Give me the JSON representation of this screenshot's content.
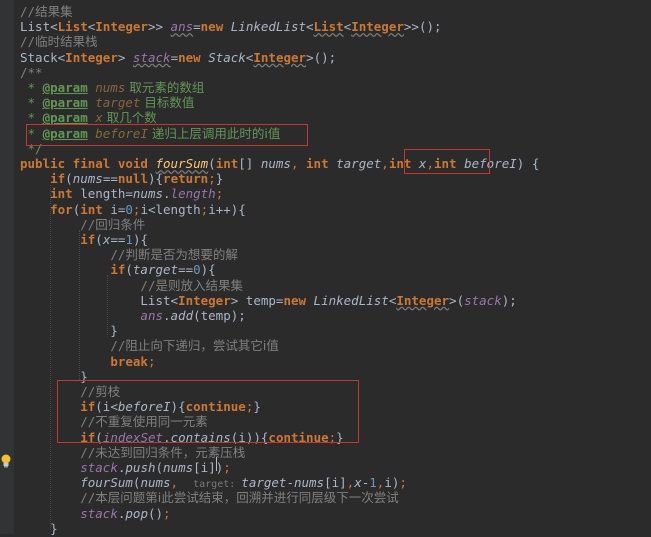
{
  "code_lines": [
    {
      "c": [
        [
          "comment",
          "//"
        ],
        [
          "cn",
          "结果集"
        ]
      ]
    },
    {
      "c": [
        [
          "type",
          "List"
        ],
        [
          "generic",
          "<"
        ],
        [
          "generic-hl",
          "List"
        ],
        [
          "generic",
          "<"
        ],
        [
          "generic-hl",
          "Integer"
        ],
        [
          "generic",
          ">> "
        ],
        [
          "field underline",
          "ans"
        ],
        [
          "type",
          "="
        ],
        [
          "kw",
          "new "
        ],
        [
          "methodcall",
          "LinkedList"
        ],
        [
          "generic",
          "<"
        ],
        [
          "generic-hl underline",
          "List"
        ],
        [
          "generic",
          "<"
        ],
        [
          "generic-hl underline",
          "Integer"
        ],
        [
          "generic",
          ">>"
        ],
        [
          "type",
          "();"
        ]
      ]
    },
    {
      "c": [
        [
          "comment",
          "//"
        ],
        [
          "cn",
          "临时结果栈"
        ]
      ]
    },
    {
      "c": [
        [
          "type",
          "Stack"
        ],
        [
          "generic",
          "<"
        ],
        [
          "generic-hl",
          "Integer"
        ],
        [
          "generic",
          "> "
        ],
        [
          "field underline",
          "stack"
        ],
        [
          "type",
          "="
        ],
        [
          "kw",
          "new "
        ],
        [
          "methodcall",
          "Stack"
        ],
        [
          "generic",
          "<"
        ],
        [
          "generic-hl underline",
          "Integer"
        ],
        [
          "generic",
          ">"
        ],
        [
          "type",
          "();"
        ]
      ]
    },
    {
      "c": [
        [
          "comment",
          "/**"
        ]
      ]
    },
    {
      "c": [
        [
          "docstar",
          " * "
        ],
        [
          "doctag",
          "@param"
        ],
        [
          "docparam",
          " nums"
        ],
        [
          "doctext",
          " 取元素的数组"
        ]
      ]
    },
    {
      "c": [
        [
          "docstar",
          " * "
        ],
        [
          "doctag",
          "@param"
        ],
        [
          "docparam",
          " target"
        ],
        [
          "doctext",
          " 目标数值"
        ]
      ]
    },
    {
      "c": [
        [
          "docstar",
          " * "
        ],
        [
          "doctag",
          "@param"
        ],
        [
          "docparam",
          " x"
        ],
        [
          "doctext",
          " 取几个数"
        ]
      ]
    },
    {
      "c": [
        [
          "docstar",
          " * "
        ],
        [
          "doctag",
          "@param"
        ],
        [
          "docparam",
          " beforeI"
        ],
        [
          "doctext",
          " 递归上层调用此时的i值"
        ]
      ]
    },
    {
      "c": [
        [
          "docstar",
          " */"
        ]
      ]
    },
    {
      "c": [
        [
          "kw",
          "public final void "
        ],
        [
          "method underline",
          "fourSum"
        ],
        [
          "type",
          "("
        ],
        [
          "kw",
          "int"
        ],
        [
          "type",
          "[] "
        ],
        [
          "param",
          "nums"
        ],
        [
          "punct",
          ", "
        ],
        [
          "kw",
          "int "
        ],
        [
          "param",
          "target"
        ],
        [
          "punct",
          ","
        ],
        [
          "kw",
          "int "
        ],
        [
          "param",
          "x"
        ],
        [
          "punct",
          ","
        ],
        [
          "kw",
          "int "
        ],
        [
          "param",
          "beforeI"
        ],
        [
          "type",
          ") {"
        ]
      ]
    },
    {
      "c": [
        [
          "type",
          "    "
        ],
        [
          "kw",
          "if"
        ],
        [
          "type",
          "("
        ],
        [
          "param",
          "nums"
        ],
        [
          "type",
          "=="
        ],
        [
          "kw",
          "null"
        ],
        [
          "type",
          "){"
        ],
        [
          "kw",
          "return"
        ],
        [
          "punct",
          ";"
        ],
        [
          "type",
          "}"
        ]
      ]
    },
    {
      "c": [
        [
          "type",
          "    "
        ],
        [
          "kw",
          "int "
        ],
        [
          "type",
          "length="
        ],
        [
          "param",
          "nums"
        ],
        [
          "type",
          "."
        ],
        [
          "field",
          "length"
        ],
        [
          "punct",
          ";"
        ]
      ]
    },
    {
      "c": [
        [
          "type",
          "    "
        ],
        [
          "kw",
          "for"
        ],
        [
          "type",
          "("
        ],
        [
          "kw",
          "int "
        ],
        [
          "type",
          "i="
        ],
        [
          "num",
          "0"
        ],
        [
          "punct",
          ";"
        ],
        [
          "type",
          "i<length"
        ],
        [
          "punct",
          ";"
        ],
        [
          "type",
          "i++){"
        ]
      ]
    },
    {
      "c": [
        [
          "type",
          "        "
        ],
        [
          "comment",
          "//"
        ],
        [
          "cn",
          "回归条件"
        ]
      ]
    },
    {
      "c": [
        [
          "type",
          "        "
        ],
        [
          "kw",
          "if"
        ],
        [
          "type",
          "("
        ],
        [
          "param",
          "x"
        ],
        [
          "type",
          "=="
        ],
        [
          "num",
          "1"
        ],
        [
          "type",
          "){"
        ]
      ]
    },
    {
      "c": [
        [
          "type",
          "            "
        ],
        [
          "comment",
          "//"
        ],
        [
          "cn",
          "判断是否为想要的解"
        ]
      ]
    },
    {
      "c": [
        [
          "type",
          "            "
        ],
        [
          "kw",
          "if"
        ],
        [
          "type",
          "("
        ],
        [
          "param",
          "target"
        ],
        [
          "type",
          "=="
        ],
        [
          "num",
          "0"
        ],
        [
          "type",
          "){"
        ]
      ]
    },
    {
      "c": [
        [
          "type",
          "                "
        ],
        [
          "comment",
          "//"
        ],
        [
          "cn",
          "是则放入结果集"
        ]
      ]
    },
    {
      "c": [
        [
          "type",
          "                List"
        ],
        [
          "generic",
          "<"
        ],
        [
          "generic-hl",
          "Integer"
        ],
        [
          "generic",
          "> "
        ],
        [
          "type",
          "temp="
        ],
        [
          "kw",
          "new "
        ],
        [
          "methodcall",
          "LinkedList"
        ],
        [
          "generic",
          "<"
        ],
        [
          "generic-hl underline",
          "Integer"
        ],
        [
          "generic",
          ">"
        ],
        [
          "type",
          "("
        ],
        [
          "field",
          "stack"
        ],
        [
          "type",
          ");"
        ]
      ]
    },
    {
      "c": [
        [
          "type",
          "                "
        ],
        [
          "field",
          "ans"
        ],
        [
          "type",
          "."
        ],
        [
          "methodcall",
          "add"
        ],
        [
          "type",
          "(temp);"
        ]
      ]
    },
    {
      "c": [
        [
          "type",
          "            }"
        ]
      ]
    },
    {
      "c": [
        [
          "type",
          "            "
        ],
        [
          "comment",
          "//"
        ],
        [
          "cn",
          "阻止向下递归，尝试其它i值"
        ]
      ]
    },
    {
      "c": [
        [
          "type",
          "            "
        ],
        [
          "kw",
          "break"
        ],
        [
          "punct",
          ";"
        ]
      ]
    },
    {
      "c": [
        [
          "type",
          "        }"
        ]
      ]
    },
    {
      "c": [
        [
          "type",
          "        "
        ],
        [
          "comment",
          "//"
        ],
        [
          "cn",
          "剪枝"
        ]
      ]
    },
    {
      "c": [
        [
          "type",
          "        "
        ],
        [
          "kw",
          "if"
        ],
        [
          "type",
          "(i<"
        ],
        [
          "param",
          "beforeI"
        ],
        [
          "type",
          "){"
        ],
        [
          "kw",
          "continue"
        ],
        [
          "punct",
          ";"
        ],
        [
          "type",
          "}"
        ]
      ]
    },
    {
      "c": [
        [
          "type",
          "        "
        ],
        [
          "comment",
          "//"
        ],
        [
          "cn",
          "不重复使用同一元素"
        ]
      ]
    },
    {
      "c": [
        [
          "type",
          "        "
        ],
        [
          "kw",
          "if"
        ],
        [
          "type",
          "("
        ],
        [
          "field",
          "indexSet"
        ],
        [
          "type",
          "."
        ],
        [
          "methodcall",
          "contains"
        ],
        [
          "type",
          "(i)){"
        ],
        [
          "kw",
          "continue"
        ],
        [
          "punct",
          ";"
        ],
        [
          "type",
          "}"
        ]
      ]
    },
    {
      "c": [
        [
          "type",
          "        "
        ],
        [
          "comment",
          "//"
        ],
        [
          "cn",
          "未达到回归条件，元素压栈"
        ]
      ]
    },
    {
      "c": [
        [
          "type",
          "        "
        ],
        [
          "field",
          "stack"
        ],
        [
          "type",
          "."
        ],
        [
          "methodcall",
          "push"
        ],
        [
          "type",
          "("
        ],
        [
          "param",
          "nums"
        ],
        [
          "type",
          "[i])"
        ],
        [
          "punct",
          ";"
        ]
      ]
    },
    {
      "c": [
        [
          "type",
          "        "
        ],
        [
          "methodcall",
          "fourSum"
        ],
        [
          "type",
          "("
        ],
        [
          "param",
          "nums"
        ],
        [
          "punct",
          ",  "
        ],
        [
          "hint-label",
          "target: "
        ],
        [
          "param",
          "target"
        ],
        [
          "type",
          "-"
        ],
        [
          "param",
          "nums"
        ],
        [
          "type",
          "[i]"
        ],
        [
          "punct",
          ","
        ],
        [
          "param",
          "x"
        ],
        [
          "type",
          "-"
        ],
        [
          "num",
          "1"
        ],
        [
          "punct",
          ","
        ],
        [
          "type",
          "i)"
        ],
        [
          "punct",
          ";"
        ]
      ]
    },
    {
      "c": [
        [
          "type",
          "        "
        ],
        [
          "comment",
          "//"
        ],
        [
          "cn",
          "本层问题第i此尝试结束，回溯并进行同层级下一次尝试"
        ]
      ]
    },
    {
      "c": [
        [
          "type",
          "        "
        ],
        [
          "field",
          "stack"
        ],
        [
          "type",
          "."
        ],
        [
          "methodcall",
          "pop"
        ],
        [
          "type",
          "()"
        ],
        [
          "punct",
          ";"
        ]
      ]
    },
    {
      "c": [
        [
          "type",
          "    }"
        ]
      ]
    }
  ],
  "colors": {
    "background": "#2b2b2b",
    "gutter": "#313335",
    "keyword": "#cc7832",
    "comment": "#808080",
    "field": "#9876aa",
    "method": "#ffc66d",
    "number": "#6897bb",
    "doc": "#629755",
    "annotation_box": "#c0392b"
  },
  "gutter_icon": "lightbulb-icon"
}
